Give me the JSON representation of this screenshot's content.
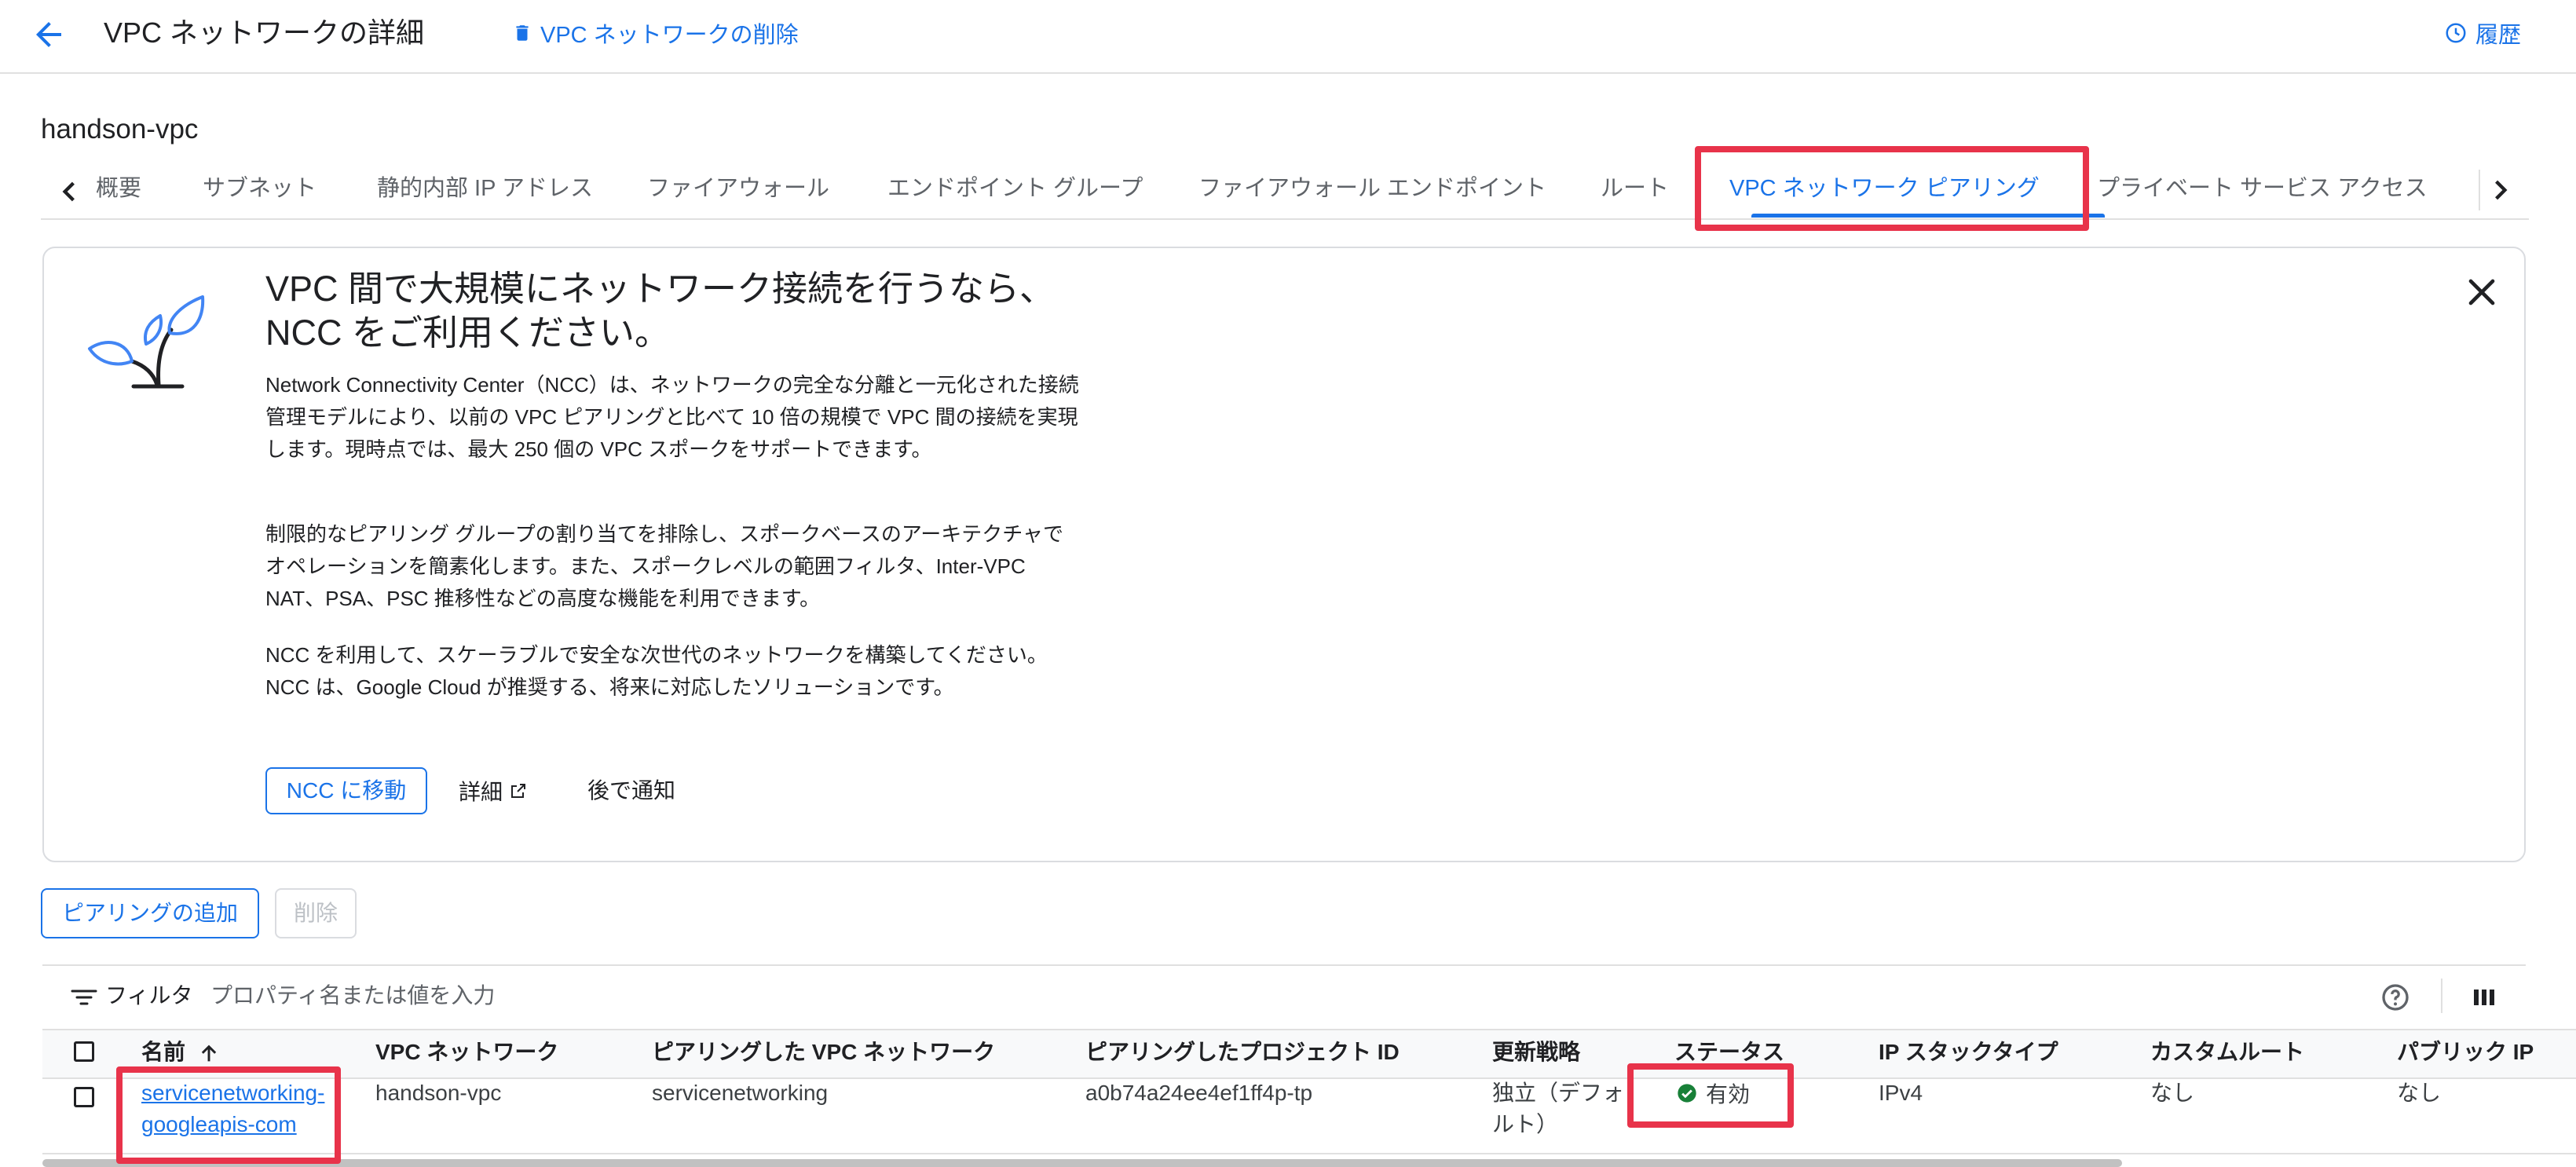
{
  "header": {
    "title": "VPC ネットワークの詳細",
    "delete_label": "VPC ネットワークの削除",
    "history_label": "履歴"
  },
  "network_name": "handson-vpc",
  "tabs": [
    {
      "label": "概要"
    },
    {
      "label": "サブネット"
    },
    {
      "label": "静的内部 IP アドレス"
    },
    {
      "label": "ファイアウォール"
    },
    {
      "label": "エンドポイント グループ"
    },
    {
      "label": "ファイアウォール エンドポイント"
    },
    {
      "label": "ルート"
    },
    {
      "label": "VPC ネットワーク ピアリング",
      "active": true
    },
    {
      "label": "プライベート サービス アクセス"
    }
  ],
  "banner": {
    "heading": "VPC 間で大規模にネットワーク接続を行うなら、NCC をご利用ください。",
    "paragraphs": [
      "Network Connectivity Center（NCC）は、ネットワークの完全な分離と一元化された接続管理モデルにより、以前の VPC ピアリングと比べて 10 倍の規模で VPC 間の接続を実現します。現時点では、最大 250 個の VPC スポークをサポートできます。",
      "制限的なピアリング グループの割り当てを排除し、スポークベースのアーキテクチャでオペレーションを簡素化します。また、スポークレベルの範囲フィルタ、Inter-VPC NAT、PSA、PSC 推移性などの高度な機能を利用できます。",
      "NCC を利用して、スケーラブルで安全な次世代のネットワークを構築してください。NCC は、Google Cloud が推奨する、将来に対応したソリューションです。"
    ],
    "primary_button": "NCC に移動",
    "details_link": "詳細",
    "later_button": "後で通知"
  },
  "actions": {
    "add_peering": "ピアリングの追加",
    "delete": "削除"
  },
  "filter": {
    "label": "フィルタ",
    "placeholder": "プロパティ名または値を入力"
  },
  "table": {
    "columns": [
      "名前",
      "VPC ネットワーク",
      "ピアリングした VPC ネットワーク",
      "ピアリングしたプロジェクト ID",
      "更新戦略",
      "ステータス",
      "IP スタックタイプ",
      "カスタムルート",
      "パブリック IP"
    ],
    "rows": [
      {
        "name_line1": "servicenetworking-",
        "name_line2": "googleapis-com",
        "vpc_network": "handson-vpc",
        "peer_network": "servicenetworking",
        "peer_project": "a0b74a24ee4ef1ff4p-tp",
        "update_strategy_line1": "独立（デフォ",
        "update_strategy_line2": "ルト）",
        "status": "有効",
        "ip_stack": "IPv4",
        "custom_routes": "なし",
        "public_ip": "なし"
      }
    ]
  },
  "colors": {
    "accent": "#1a73e8",
    "highlight": "#e8334a",
    "status_ok": "#188038"
  }
}
